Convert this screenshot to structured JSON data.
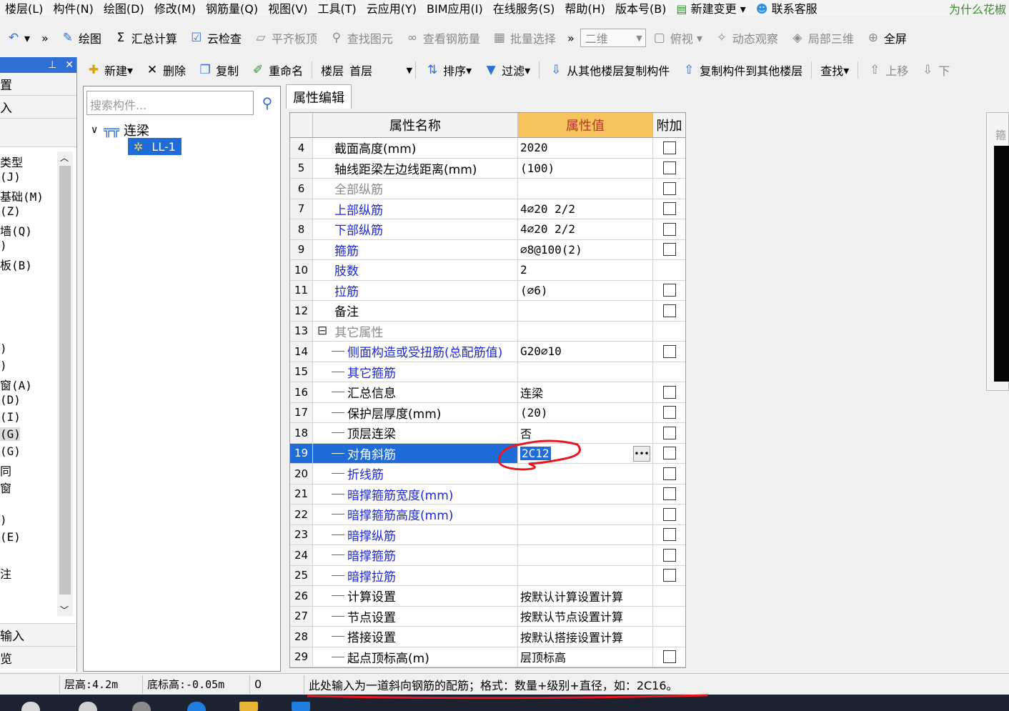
{
  "menu": {
    "items": [
      "楼层(L)",
      "构件(N)",
      "绘图(D)",
      "修改(M)",
      "钢筋量(Q)",
      "视图(V)",
      "工具(T)",
      "云应用(Y)",
      "BIM应用(I)",
      "在线服务(S)",
      "帮助(H)",
      "版本号(B)",
      "新建变更",
      "联系客服"
    ],
    "right_link": "为什么花椒"
  },
  "toolbar1": {
    "draw": "绘图",
    "sum": "汇总计算",
    "cloud_check": "云检查",
    "flat_top": "平齐板顶",
    "find_elem": "查找图元",
    "view_rebar": "查看钢筋量",
    "batch_select": "批量选择",
    "view_2d": "二维",
    "top_view": "俯视",
    "dynamic": "动态观察",
    "local3d": "局部三维",
    "fullscreen": "全屏"
  },
  "left_panel": {
    "row1": "置",
    "row2": "入",
    "items": [
      "类型",
      "(J)",
      "基础(M)",
      "(Z)",
      "墙(Q)",
      ")",
      "板(B)",
      ")",
      ")",
      "窗(A)",
      "(D)",
      "(I)",
      "(G)",
      "(G)",
      "同",
      "窗",
      ")",
      "(E)",
      "注"
    ],
    "bottom1": "输入",
    "bottom2": "览"
  },
  "toolbar2": {
    "new": "新建",
    "delete": "删除",
    "copy": "复制",
    "rename": "重命名",
    "floor_label": "楼层",
    "floor_value": "首层",
    "sort": "排序",
    "filter": "过滤",
    "copy_from": "从其他楼层复制构件",
    "copy_to": "复制构件到其他楼层",
    "find": "查找",
    "up": "上移",
    "down": "下"
  },
  "component_panel": {
    "search_placeholder": "搜索构件...",
    "root": "连梁",
    "child": "LL-1"
  },
  "tab": {
    "label": "属性编辑"
  },
  "grid": {
    "headers": {
      "name": "属性名称",
      "value": "属性值",
      "extra": "附加"
    },
    "rows": [
      {
        "n": "4",
        "name": "截面高度(mm)",
        "value": "2020",
        "style": "",
        "cb": true
      },
      {
        "n": "5",
        "name": "轴线距梁左边线距离(mm)",
        "value": "(100)",
        "style": "",
        "cb": true
      },
      {
        "n": "6",
        "name": "全部纵筋",
        "value": "",
        "style": "gray",
        "cb": true
      },
      {
        "n": "7",
        "name": "上部纵筋",
        "value": "4⌀20 2/2",
        "style": "blue",
        "cb": true
      },
      {
        "n": "8",
        "name": "下部纵筋",
        "value": "4⌀20 2/2",
        "style": "blue",
        "cb": true
      },
      {
        "n": "9",
        "name": "箍筋",
        "value": "⌀8@100(2)",
        "style": "blue",
        "cb": true
      },
      {
        "n": "10",
        "name": "肢数",
        "value": "2",
        "style": "blue",
        "cb": false
      },
      {
        "n": "11",
        "name": "拉筋",
        "value": "(⌀6)",
        "style": "blue",
        "cb": true
      },
      {
        "n": "12",
        "name": "备注",
        "value": "",
        "style": "",
        "cb": true
      },
      {
        "n": "13",
        "name": "其它属性",
        "value": "",
        "style": "gray",
        "cb": false,
        "group": true
      },
      {
        "n": "14",
        "name": "侧面构造或受扭筋(总配筋值)",
        "value": "G20⌀10",
        "style": "blue",
        "cb": true,
        "indent": true
      },
      {
        "n": "15",
        "name": "其它箍筋",
        "value": "",
        "style": "blue",
        "cb": false,
        "indent": true
      },
      {
        "n": "16",
        "name": "汇总信息",
        "value": "连梁",
        "style": "",
        "cb": true,
        "indent": true
      },
      {
        "n": "17",
        "name": "保护层厚度(mm)",
        "value": "(20)",
        "style": "",
        "cb": true,
        "indent": true
      },
      {
        "n": "18",
        "name": "顶层连梁",
        "value": "否",
        "style": "",
        "cb": true,
        "indent": true
      },
      {
        "n": "19",
        "name": "对角斜筋",
        "value": "2C12",
        "style": "",
        "cb": true,
        "indent": true,
        "selected": true
      },
      {
        "n": "20",
        "name": "折线筋",
        "value": "",
        "style": "blue",
        "cb": true,
        "indent": true
      },
      {
        "n": "21",
        "name": "暗撑箍筋宽度(mm)",
        "value": "",
        "style": "blue",
        "cb": true,
        "indent": true
      },
      {
        "n": "22",
        "name": "暗撑箍筋高度(mm)",
        "value": "",
        "style": "blue",
        "cb": true,
        "indent": true
      },
      {
        "n": "23",
        "name": "暗撑纵筋",
        "value": "",
        "style": "blue",
        "cb": true,
        "indent": true
      },
      {
        "n": "24",
        "name": "暗撑箍筋",
        "value": "",
        "style": "blue",
        "cb": true,
        "indent": true
      },
      {
        "n": "25",
        "name": "暗撑拉筋",
        "value": "",
        "style": "blue",
        "cb": true,
        "indent": true
      },
      {
        "n": "26",
        "name": "计算设置",
        "value": "按默认计算设置计算",
        "style": "",
        "cb": false,
        "indent": true
      },
      {
        "n": "27",
        "name": "节点设置",
        "value": "按默认节点设置计算",
        "style": "",
        "cb": false,
        "indent": true
      },
      {
        "n": "28",
        "name": "搭接设置",
        "value": "按默认搭接设置计算",
        "style": "",
        "cb": false,
        "indent": true
      },
      {
        "n": "29",
        "name": "起点顶标高(m)",
        "value": "层顶标高",
        "style": "",
        "cb": true,
        "indent": true
      }
    ]
  },
  "right_panel": {
    "label": "箍"
  },
  "status": {
    "floor_height": "层高:4.2m",
    "base_elev": "底标高:-0.05m",
    "zero": "0",
    "hint": "此处输入为一道斜向钢筋的配筋；格式：数量+级别+直径，如：2C16。"
  },
  "colors": {
    "accent": "#1f6bd8",
    "header_value": "#f6c35c",
    "annotation": "#e5191f"
  }
}
